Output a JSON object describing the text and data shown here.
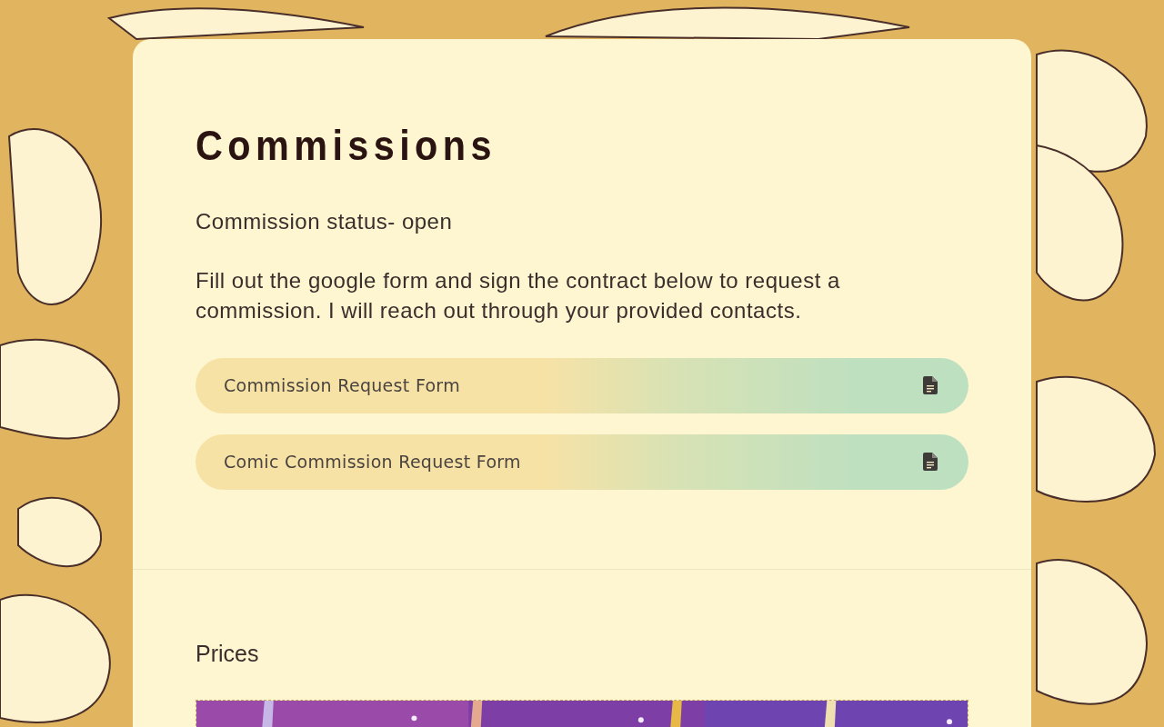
{
  "commissions": {
    "title": "Commissions",
    "status": "Commission status- open",
    "description": "Fill out the google form and sign the contract below to request a commission. I will reach out through your provided contacts.",
    "links": [
      {
        "label": "Commission Request Form"
      },
      {
        "label": "Comic Commission Request Form"
      }
    ]
  },
  "prices": {
    "heading": "Prices"
  }
}
